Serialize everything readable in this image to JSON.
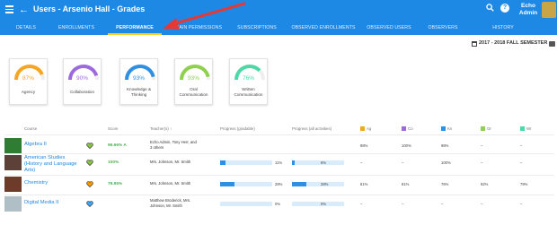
{
  "header": {
    "title": "Users - Arsenio Hall - Grades",
    "user_name_line1": "Echo",
    "user_name_line2": "Admin",
    "help_glyph": "?"
  },
  "tabs": [
    {
      "label": "DETAILS"
    },
    {
      "label": "ENROLLMENTS"
    },
    {
      "label": "PERFORMANCE",
      "active": true
    },
    {
      "label": "DOMAIN PERMISSIONS"
    },
    {
      "label": "SUBSCRIPTIONS"
    },
    {
      "label": "OBSERVED ENROLLMENTS"
    },
    {
      "label": "OBSERVED USERS"
    },
    {
      "label": "OBSERVERS"
    },
    {
      "label": "HISTORY"
    }
  ],
  "semester": "2017 - 2018 FALL SEMESTER",
  "cards": [
    {
      "pct": "87%",
      "value": 0.87,
      "color": "#f5a623",
      "label1": "Agency",
      "label2": ""
    },
    {
      "pct": "90%",
      "value": 0.9,
      "color": "#9c6ade",
      "label1": "Collaboration",
      "label2": ""
    },
    {
      "pct": "93%",
      "value": 0.93,
      "color": "#2f8fe3",
      "label1": "Knowledge &",
      "label2": "Thinking"
    },
    {
      "pct": "93%",
      "value": 0.93,
      "color": "#8fd14f",
      "label1": "Oral",
      "label2": "Communication"
    },
    {
      "pct": "76%",
      "value": 0.76,
      "color": "#4ed8a8",
      "label1": "Written",
      "label2": "Communication"
    }
  ],
  "table": {
    "headers": {
      "course": "Course",
      "score": "Score",
      "teachers": "Teacher(s) ↑",
      "progress_gradable": "Progress (gradable)",
      "progress_all": "Progress (all activities)",
      "ag": "Ag",
      "co": "Co",
      "kn": "Kn",
      "or": "Or",
      "wr": "Wr"
    },
    "header_colors": {
      "ag": "#f5a623",
      "co": "#9c6ade",
      "kn": "#2f8fe3",
      "or": "#8fd14f",
      "wr": "#4ed8a8"
    },
    "rows": [
      {
        "course_line1": "Algebra II",
        "course_line2": "",
        "course_line3": "",
        "heart": "#8bc34a",
        "thumb": "#2e7d32",
        "score": "96.66% A",
        "teacher_line1": "Echo Admin, Tony Herr, and",
        "teacher_line2": "3 others",
        "gradable": "",
        "gradable_value": null,
        "all": "",
        "all_value": null,
        "ag": "98%",
        "co": "100%",
        "kn": "98%",
        "or": "–",
        "wr": "–"
      },
      {
        "course_line1": "American Studies",
        "course_line2": "(History and Language",
        "course_line3": "Arts)",
        "heart": "#8bc34a",
        "thumb": "#5d4037",
        "score": "100%",
        "teacher_line1": "Mrs. Johnson, Mr. Smith",
        "teacher_line2": "",
        "gradable": "11%",
        "gradable_value": 0.11,
        "all": "6%",
        "all_value": 0.06,
        "ag": "–",
        "co": "–",
        "kn": "100%",
        "or": "–",
        "wr": "–"
      },
      {
        "course_line1": "Chemistry",
        "course_line2": "",
        "course_line3": "",
        "heart": "#ff9800",
        "thumb": "#6d3b2a",
        "score": "79.95%",
        "teacher_line1": "Mrs. Johnson, Mr. Smith",
        "teacher_line2": "",
        "gradable": "28%",
        "gradable_value": 0.28,
        "all": "28%",
        "all_value": 0.28,
        "ag": "81%",
        "co": "81%",
        "kn": "76%",
        "or": "92%",
        "wr": "79%"
      },
      {
        "course_line1": "Digital Media II",
        "course_line2": "",
        "course_line3": "",
        "heart": "#42a5f5",
        "thumb": "#b0bec5",
        "score": "",
        "teacher_line1": "Matthew Broderick, Mrs.",
        "teacher_line2": "Johnson, Mr. Smith",
        "gradable": "0%",
        "gradable_value": 0.0,
        "all": "0%",
        "all_value": 0.0,
        "ag": "–",
        "co": "–",
        "kn": "–",
        "or": "–",
        "wr": "–"
      }
    ]
  }
}
